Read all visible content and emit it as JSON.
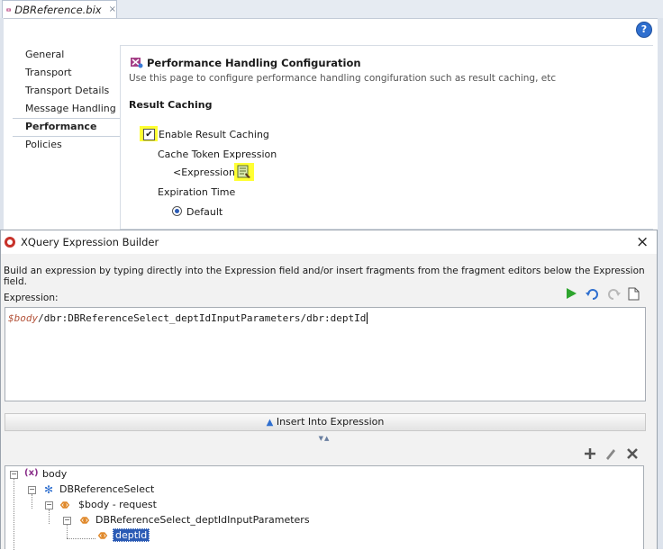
{
  "editor": {
    "tab_title": "DBReference.bix",
    "tab_close": "×",
    "help": "?",
    "nav_items": [
      "General",
      "Transport",
      "Transport Details",
      "Message Handling",
      "Performance",
      "Policies"
    ],
    "selected_nav": "Performance",
    "heading": "Performance Handling Configuration",
    "description": "Use this page to configure performance handling congifuration such as result caching, etc",
    "section_title": "Result Caching",
    "enable_caching_label": "Enable Result Caching",
    "enable_caching_checked": true,
    "cache_token_label": "Cache Token Expression",
    "expression_link": "<Expression>",
    "expiration_label": "Expiration Time",
    "default_label": "Default"
  },
  "dialog": {
    "title": "XQuery Expression Builder",
    "close": "×",
    "instructions": "Build an expression by typing directly into the Expression field and/or insert fragments from the fragment editors below the Expression field.",
    "expression_label": "Expression:",
    "expression_var": "$body",
    "expression_rest": "/dbr:DBReferenceSelect_deptIdInputParameters/dbr:deptId",
    "insert_button": "Insert Into Expression",
    "tree": [
      {
        "label": "body",
        "level": 0
      },
      {
        "label": "DBReferenceSelect",
        "level": 1
      },
      {
        "label": "$body - request",
        "level": 2
      },
      {
        "label": "DBReferenceSelect_deptIdInputParameters",
        "level": 3
      },
      {
        "label": "deptId",
        "level": 4,
        "selected": true
      }
    ]
  },
  "colors": {
    "highlight": "#ffff33",
    "selection": "#2b5bb5",
    "var_color": "#b4533a"
  }
}
